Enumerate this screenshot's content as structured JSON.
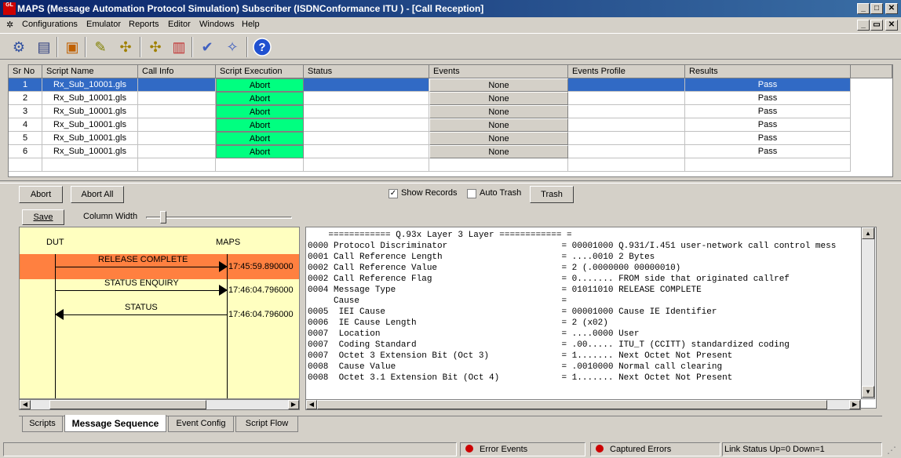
{
  "window": {
    "title": "MAPS (Message Automation Protocol Simulation) Subscriber (ISDNConformance ITU ) - [Call Reception]",
    "logo_text": "GL"
  },
  "menu": [
    "Configurations",
    "Emulator",
    "Reports",
    "Editor",
    "Windows",
    "Help"
  ],
  "grid": {
    "headers": [
      "Sr No",
      "Script Name",
      "Call Info",
      "Script Execution",
      "Status",
      "Events",
      "Events Profile",
      "Results"
    ],
    "rows": [
      {
        "sr": "1",
        "script": "Rx_Sub_10001.gls",
        "exec": "Abort",
        "events": "None",
        "result": "Pass"
      },
      {
        "sr": "2",
        "script": "Rx_Sub_10001.gls",
        "exec": "Abort",
        "events": "None",
        "result": "Pass"
      },
      {
        "sr": "3",
        "script": "Rx_Sub_10001.gls",
        "exec": "Abort",
        "events": "None",
        "result": "Pass"
      },
      {
        "sr": "4",
        "script": "Rx_Sub_10001.gls",
        "exec": "Abort",
        "events": "None",
        "result": "Pass"
      },
      {
        "sr": "5",
        "script": "Rx_Sub_10001.gls",
        "exec": "Abort",
        "events": "None",
        "result": "Pass"
      },
      {
        "sr": "6",
        "script": "Rx_Sub_10001.gls",
        "exec": "Abort",
        "events": "None",
        "result": "Pass"
      }
    ]
  },
  "controls": {
    "abort": "Abort",
    "abort_all": "Abort All",
    "show_records": "Show Records",
    "show_records_checked": true,
    "auto_trash": "Auto Trash",
    "auto_trash_checked": false,
    "trash": "Trash",
    "save": "Save",
    "column_width": "Column Width"
  },
  "sequence": {
    "left_label": "DUT",
    "right_label": "MAPS",
    "messages": [
      {
        "name": "RELEASE COMPLETE",
        "time": "17:45:59.890000",
        "direction": "right",
        "highlighted": true
      },
      {
        "name": "STATUS ENQUIRY",
        "time": "17:46:04.796000",
        "direction": "right",
        "highlighted": false
      },
      {
        "name": "STATUS",
        "time": "17:46:04.796000",
        "direction": "left",
        "highlighted": false
      }
    ]
  },
  "decode": [
    "    ============ Q.93x Layer 3 Layer ============ =",
    "0000 Protocol Discriminator                      = 00001000 Q.931/I.451 user-network call control mess",
    "0001 Call Reference Length                       = ....0010 2 Bytes",
    "0002 Call Reference Value                        = 2 (.0000000 00000010)",
    "0002 Call Reference Flag                         = 0....... FROM side that originated callref",
    "0004 Message Type                                = 01011010 RELEASE COMPLETE",
    "     Cause                                       =",
    "0005  IEI Cause                                  = 00001000 Cause IE Identifier",
    "0006  IE Cause Length                            = 2 (x02)",
    "0007  Location                                   = ....0000 User",
    "0007  Coding Standard                            = .00..... ITU_T (CCITT) standardized coding",
    "0007  Octet 3 Extension Bit (Oct 3)              = 1....... Next Octet Not Present",
    "0008  Cause Value                                = .0010000 Normal call clearing",
    "0008  Octet 3.1 Extension Bit (Oct 4)            = 1....... Next Octet Not Present"
  ],
  "tabs": [
    "Scripts",
    "Message Sequence",
    "Event Config",
    "Script Flow"
  ],
  "active_tab": "Message Sequence",
  "statusbar": {
    "error_events": "Error Events",
    "captured_errors": "Captured Errors",
    "link_status": "Link Status Up=0 Down=1"
  },
  "colors": {
    "abort_bg": "#00ff80",
    "highlight_row": "#ff8040",
    "selection": "#316ac5",
    "sequence_bg": "#ffffc0"
  }
}
